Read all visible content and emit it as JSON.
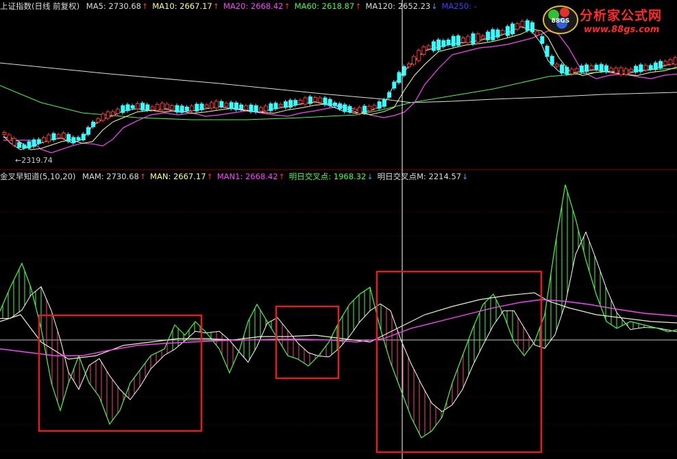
{
  "top_legend": {
    "title": "上证指数(日线 前复权)",
    "items": [
      {
        "label": "MA5: 2730.68",
        "arrow": "↑",
        "color": "#dcdcdc"
      },
      {
        "label": "MA10: 2667.17",
        "arrow": "↑",
        "color": "#ffff80"
      },
      {
        "label": "MA20: 2668.42",
        "arrow": "↑",
        "color": "#ff40ff"
      },
      {
        "label": "MA60: 2618.87",
        "arrow": "↑",
        "color": "#40ff40"
      },
      {
        "label": "MA120: 2652.23",
        "arrow": "↓",
        "color": "#dcdcdc"
      },
      {
        "label": "MA250: -",
        "arrow": "",
        "color": "#4040ff"
      }
    ],
    "min_label": "←2319.74"
  },
  "bottom_legend": {
    "title": "金叉早知道(5,10,20)",
    "items": [
      {
        "label": "MAM: 2730.68",
        "arrow": "↑",
        "color": "#dcdcdc"
      },
      {
        "label": "MAN: 2667.17",
        "arrow": "↑",
        "color": "#ffff80"
      },
      {
        "label": "MAN1: 2668.42",
        "arrow": "↑",
        "color": "#ff40ff"
      },
      {
        "label": "明日交叉点: 1968.32",
        "arrow": "↓",
        "color": "#40ff40"
      },
      {
        "label": "明日交叉点M: 2214.57",
        "arrow": "↓",
        "color": "#dcdcdc"
      }
    ]
  },
  "watermark": {
    "title": "分析家公式网",
    "url": "www.88gs.com",
    "logo_text": "88GS"
  },
  "colors": {
    "up": "#ff3333",
    "down": "#33ffff",
    "ma5": "#e8e8e8",
    "ma10": "#ffff80",
    "ma20": "#ff40ff",
    "ma60": "#40ff40",
    "ma120": "#e0e0e0",
    "osc_pos": "#40ff40",
    "osc_neg": "#ff4080",
    "box": "#e02020",
    "divider": "#8b0000",
    "crosshair": "#ffffff"
  },
  "chart_data": {
    "type": "line",
    "panels": [
      "price-kline",
      "oscillator"
    ],
    "min_price_marker": 2319.74
  }
}
